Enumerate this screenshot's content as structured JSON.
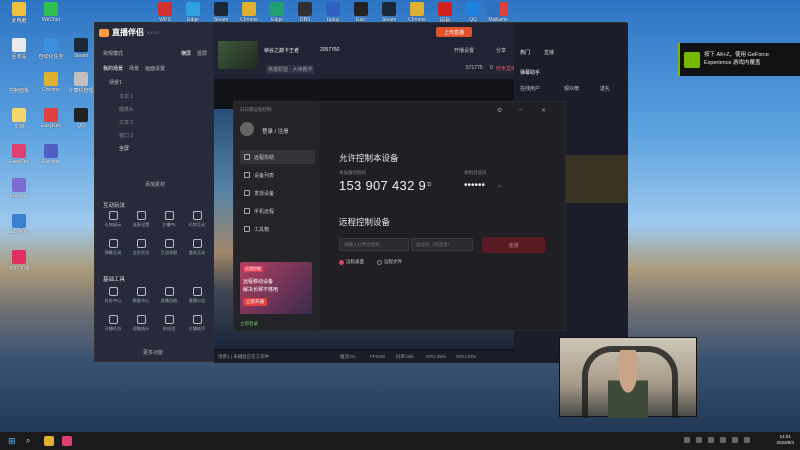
{
  "desktop": {
    "icons": [
      {
        "label": "此电脑",
        "color": "#f0c040"
      },
      {
        "label": "WeChat",
        "color": "#2fbf4f"
      },
      {
        "label": "回收站",
        "color": "#eaeaea"
      },
      {
        "label": "自动化任务",
        "color": "#3a8fe0"
      },
      {
        "label": "Steam",
        "color": "#1b2838"
      },
      {
        "label": "控制面板",
        "color": "#4a90d9"
      },
      {
        "label": "Chrome",
        "color": "#e0b030"
      },
      {
        "label": "计算机管理",
        "color": "#c0c0c0"
      },
      {
        "label": "文档",
        "color": "#f5d76e"
      },
      {
        "label": "EasyRec",
        "color": "#e04040"
      },
      {
        "label": "QQ",
        "color": "#222222"
      },
      {
        "label": "EasyRec",
        "color": "#e04070"
      },
      {
        "label": "Easybar",
        "color": "#5060c0"
      },
      {
        "label": "实时主播",
        "color": "#e03060"
      }
    ],
    "top_icons": [
      "WPS",
      "Edge",
      "Steam",
      "Chrome",
      "Edge",
      "OBS",
      "Uplay",
      "Epic",
      "Steam",
      "Chrome",
      "网易",
      "QQ",
      "Game",
      "Mail"
    ]
  },
  "app": {
    "brand_name": "直播伴侣",
    "brand_version": "9.4.0.2",
    "left": {
      "mode_label": "常规模式",
      "mode_tabs": [
        "横屏",
        "竖屏"
      ],
      "scene_tabs": [
        "我的场景",
        "场景",
        "画面设置"
      ],
      "scene_group": "场景1",
      "sources": [
        "文本 1",
        "摄像头",
        "文本 2",
        "窗口 3",
        "全屏"
      ],
      "add_source": "添加素材",
      "interaction_title": "互动玩法",
      "interaction_tools": [
        "礼物展示",
        "连麦设置",
        "主播PK",
        "礼物互动",
        "弹幕互动",
        "全民任务",
        "互动答题",
        "道具互动"
      ],
      "basic_title": "基础工具",
      "basic_tools": [
        "任务中心",
        "数据中心",
        "直播回放",
        "直播公告",
        "开播任务",
        "观看统计",
        "粉丝团",
        "主播助手"
      ],
      "more_tools": "更多功能"
    },
    "header": {
      "title": "峡谷之巅卡王者",
      "room_id": "2057760",
      "subtitle": "英雄联盟 · 大神教学",
      "upload_label": "上传直播",
      "share_label": "分享",
      "open_live_label": "开播设置",
      "end_label": "结束直播",
      "viewer_count": "571775",
      "likes": "0"
    },
    "status_bar": {
      "scene": "场景1 | 未播放正在工作中",
      "stats": [
        "推流1%",
        "FPS:60",
        "码率:0kb",
        "CPU:35%",
        "GPU:40%"
      ]
    },
    "right_panel": {
      "tabs": [
        "热门",
        "直播"
      ],
      "title": "弹幕助手",
      "items": [
        "在线用户",
        "观众榜",
        "送礼"
      ]
    }
  },
  "dialog": {
    "app_title": "向日葵远程控制",
    "user_name": "登录 / 注册",
    "nav": [
      {
        "label": "远程协助",
        "active": true
      },
      {
        "label": "设备列表",
        "active": false
      },
      {
        "label": "发现设备",
        "active": false
      },
      {
        "label": "手机远程",
        "active": false
      },
      {
        "label": "工具箱",
        "active": false
      }
    ],
    "promo_line1": "远程移动设备",
    "promo_line2": "解决长臂不够用",
    "promo_button": "立即开通",
    "promo_tag": "远程控制",
    "login_hint": "立即登录",
    "allow_title": "允许控制本设备",
    "device_code_label": "本设备识别码",
    "device_code": "153 907 432 9",
    "password_label": "本机验证码",
    "password_mask": "••••••",
    "remote_title": "远程控制设备",
    "partner_placeholder": "请输入伙伴识别码",
    "partner_pwd_placeholder": "验证码（可选填）",
    "connect_button": "连接",
    "radio_options": [
      {
        "label": "远程桌面",
        "checked": true
      },
      {
        "label": "远程文件",
        "checked": false
      }
    ]
  },
  "nvidia_notice": "按下 Alt+Z，使用 GeForce Experience 游戏内覆盖",
  "taskbar": {
    "time": "14:01",
    "date": "2023/8/3"
  }
}
